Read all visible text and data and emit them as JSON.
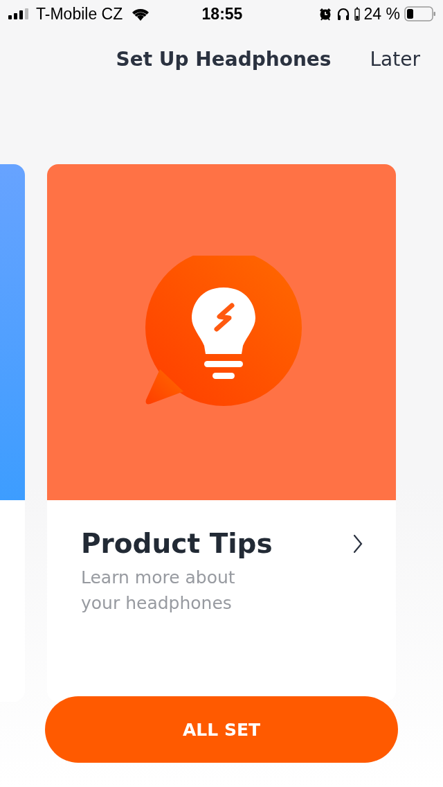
{
  "status_bar": {
    "carrier": "T-Mobile CZ",
    "time": "18:55",
    "battery": "24 %"
  },
  "header": {
    "title": "Set Up Headphones",
    "action": "Later"
  },
  "cards": [
    {
      "kind": "partial"
    },
    {
      "kind": "tip",
      "title": "Product Tips",
      "subtitle": "Learn more about your headphones"
    }
  ],
  "button": {
    "label": "ALL SET"
  }
}
